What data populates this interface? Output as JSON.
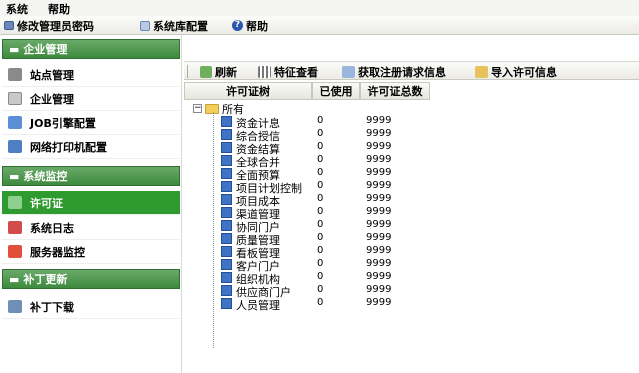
{
  "menubar": {
    "items": [
      "系统",
      "帮助"
    ]
  },
  "toolbar": {
    "change_password": "修改管理员密码",
    "system_config": "系统库配置",
    "help": "帮助"
  },
  "sidebar": {
    "sections": [
      {
        "title": "企业管理",
        "items": [
          "站点管理",
          "企业管理",
          "JOB引擎配置",
          "网络打印机配置"
        ]
      },
      {
        "title": "系统监控",
        "items": [
          "许可证",
          "系统日志",
          "服务器监控"
        ],
        "active": "许可证"
      },
      {
        "title": "补丁更新",
        "items": [
          "补丁下载"
        ]
      }
    ]
  },
  "content_toolbar": {
    "refresh": "刷新",
    "feature_view": "特征查看",
    "get_registration": "获取注册请求信息",
    "import_license": "导入许可信息"
  },
  "table": {
    "headers": [
      "许可证树",
      "已使用",
      "许可证总数"
    ],
    "root": "所有",
    "rows": [
      {
        "name": "资金计息",
        "used": "0",
        "total": "9999"
      },
      {
        "name": "综合授信",
        "used": "0",
        "total": "9999"
      },
      {
        "name": "资金结算",
        "used": "0",
        "total": "9999"
      },
      {
        "name": "全球合并",
        "used": "0",
        "total": "9999"
      },
      {
        "name": "全面预算",
        "used": "0",
        "total": "9999"
      },
      {
        "name": "项目计划控制",
        "used": "0",
        "total": "9999"
      },
      {
        "name": "项目成本",
        "used": "0",
        "total": "9999"
      },
      {
        "name": "渠道管理",
        "used": "0",
        "total": "9999"
      },
      {
        "name": "协同门户",
        "used": "0",
        "total": "9999"
      },
      {
        "name": "质量管理",
        "used": "0",
        "total": "9999"
      },
      {
        "name": "看板管理",
        "used": "0",
        "total": "9999"
      },
      {
        "name": "客户门户",
        "used": "0",
        "total": "9999"
      },
      {
        "name": "组织机构",
        "used": "0",
        "total": "9999"
      },
      {
        "name": "供应商门户",
        "used": "0",
        "total": "9999"
      },
      {
        "name": "人员管理",
        "used": "0",
        "total": "9999"
      }
    ]
  },
  "colors": {
    "section_header": "#4a944a",
    "active_item": "#2f9a2f",
    "leaf_icon": "#3f73c8",
    "folder_icon": "#f2cf5a"
  }
}
